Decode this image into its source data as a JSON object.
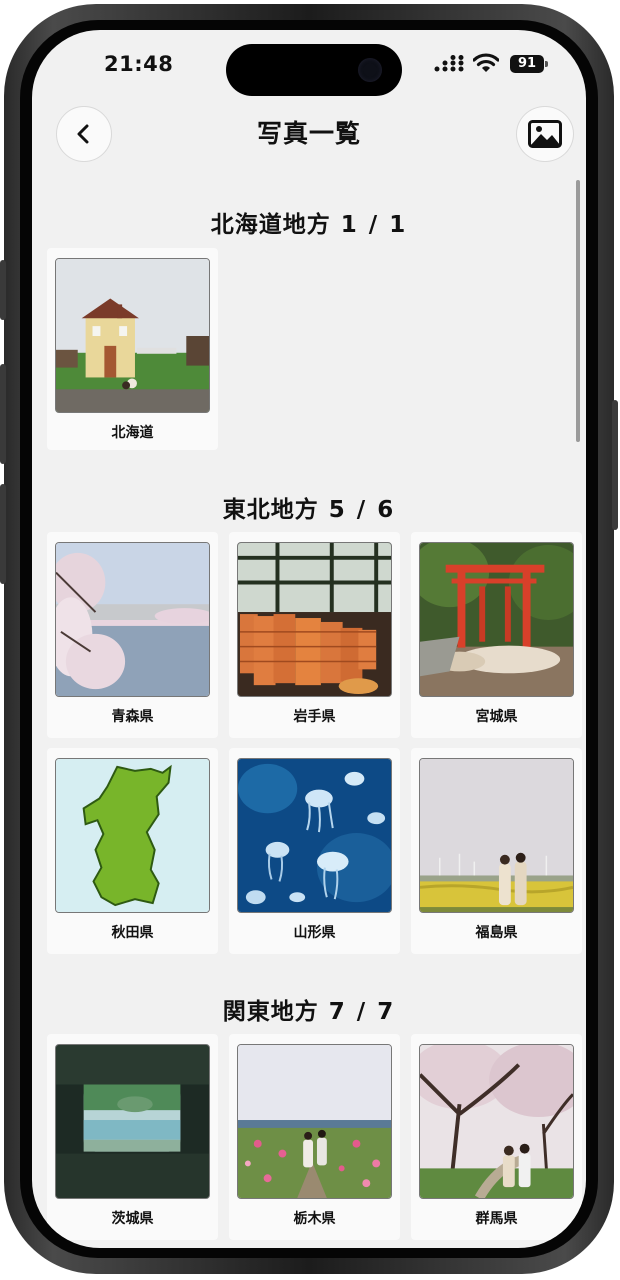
{
  "status": {
    "time": "21:48",
    "battery": "91"
  },
  "header": {
    "title": "写真一覧"
  },
  "sections": [
    {
      "name": "北海道地方",
      "count": "1 / 1",
      "items": [
        {
          "label": "北海道"
        }
      ]
    },
    {
      "name": "東北地方",
      "count": "5 / 6",
      "items": [
        {
          "label": "青森県"
        },
        {
          "label": "岩手県"
        },
        {
          "label": "宮城県"
        },
        {
          "label": "秋田県"
        },
        {
          "label": "山形県"
        },
        {
          "label": "福島県"
        }
      ]
    },
    {
      "name": "関東地方",
      "count": "7 / 7",
      "items": [
        {
          "label": "茨城県"
        },
        {
          "label": "栃木県"
        },
        {
          "label": "群馬県"
        }
      ]
    }
  ],
  "colors": {
    "screen_bg": "#f1f1f1",
    "card_bg": "#fafafa",
    "text": "#111111"
  }
}
